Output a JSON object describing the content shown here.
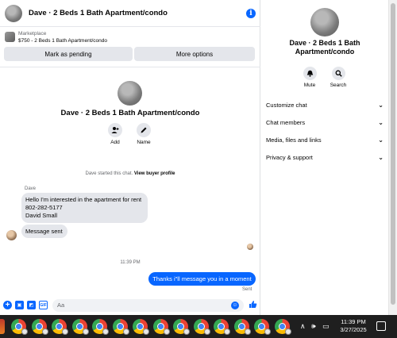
{
  "header": {
    "title": "Dave · 2 Beds 1 Bath Apartment/condo"
  },
  "listing": {
    "source": "Marketplace",
    "price_title": "$750 - 2 Beds 1 Bath Apartment/condo",
    "pending_label": "Mark as pending",
    "more_label": "More options"
  },
  "conversation": {
    "title": "Dave · 2 Beds 1 Bath Apartment/condo",
    "add_label": "Add",
    "name_label": "Name",
    "started_text": "Dave started this chat.",
    "profile_link": "View buyer profile",
    "sender": "Dave",
    "incoming": [
      {
        "lines": [
          "Hello I'm interested in the apartment for rent",
          "802-282-5177",
          "David Small"
        ]
      },
      {
        "lines": [
          "Message sent"
        ]
      }
    ],
    "timestamp": "11:39 PM",
    "outgoing": "Thanks i\"ll message you in a moment",
    "status": "Sent"
  },
  "composer": {
    "placeholder": "Aa"
  },
  "side_panel": {
    "title_line1": "Dave · 2 Beds 1 Bath",
    "title_line2": "Apartment/condo",
    "mute_label": "Mute",
    "search_label": "Search",
    "sections": [
      "Customize chat",
      "Chat members",
      "Media, files and links",
      "Privacy & support"
    ]
  },
  "taskbar": {
    "app_icon_count": 14,
    "time": "11:39 PM",
    "date": "3/27/2025"
  },
  "colors": {
    "accent": "#0866ff",
    "bubble_in": "#e4e6eb",
    "taskbar": "#1f1f1f"
  },
  "icons": [
    "info-icon",
    "person-add-icon",
    "pencil-icon",
    "bell-icon",
    "search-icon",
    "chevron-down-icon",
    "plus-icon",
    "sticker-icon",
    "gif-icon",
    "emoji-icon",
    "thumbs-up-icon",
    "chrome-icon"
  ]
}
